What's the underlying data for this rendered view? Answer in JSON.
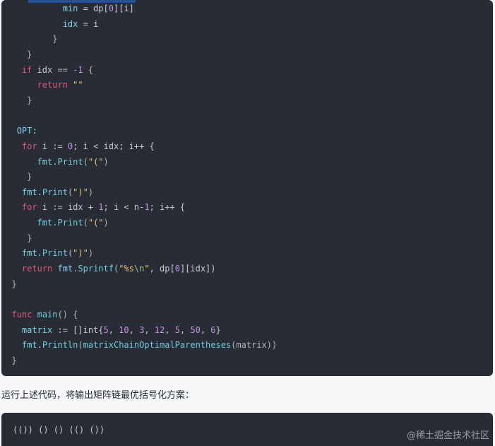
{
  "code": {
    "lines": [
      [
        {
          "t": "            "
        },
        {
          "t": "min",
          "c": "var"
        },
        {
          "t": " = dp[",
          "c": "op"
        },
        {
          "t": "0",
          "c": "num"
        },
        {
          "t": "][i]",
          "c": "op"
        }
      ],
      [
        {
          "t": "            "
        },
        {
          "t": "idx",
          "c": "var"
        },
        {
          "t": " = i",
          "c": "op"
        }
      ],
      [
        {
          "t": "          "
        },
        {
          "t": "}",
          "c": "punc"
        }
      ],
      [
        {
          "t": "     "
        },
        {
          "t": "}",
          "c": "punc"
        }
      ],
      [
        {
          "t": "    "
        },
        {
          "t": "if",
          "c": "kw"
        },
        {
          "t": " idx == ",
          "c": "op"
        },
        {
          "t": "-1",
          "c": "num"
        },
        {
          "t": " {",
          "c": "punc"
        }
      ],
      [
        {
          "t": "       "
        },
        {
          "t": "return",
          "c": "kw"
        },
        {
          "t": " ",
          "c": "op"
        },
        {
          "t": "\"\"",
          "c": "str"
        }
      ],
      [
        {
          "t": "     "
        },
        {
          "t": "}",
          "c": "punc"
        }
      ],
      [],
      [
        {
          "t": "   "
        },
        {
          "t": "OPT:",
          "c": "var"
        }
      ],
      [
        {
          "t": "    "
        },
        {
          "t": "for",
          "c": "kw"
        },
        {
          "t": " i := ",
          "c": "op"
        },
        {
          "t": "0",
          "c": "num"
        },
        {
          "t": "; i < idx; i++ {",
          "c": "op"
        }
      ],
      [
        {
          "t": "       "
        },
        {
          "t": "fmt.",
          "c": "var"
        },
        {
          "t": "Print",
          "c": "fn"
        },
        {
          "t": "(",
          "c": "punc"
        },
        {
          "t": "\"(\"",
          "c": "str"
        },
        {
          "t": ")",
          "c": "punc"
        }
      ],
      [
        {
          "t": "     "
        },
        {
          "t": "}",
          "c": "punc"
        }
      ],
      [
        {
          "t": "    "
        },
        {
          "t": "fmt.",
          "c": "var"
        },
        {
          "t": "Print",
          "c": "fn"
        },
        {
          "t": "(",
          "c": "punc"
        },
        {
          "t": "\")\"",
          "c": "str"
        },
        {
          "t": ")",
          "c": "punc"
        }
      ],
      [
        {
          "t": "    "
        },
        {
          "t": "for",
          "c": "kw"
        },
        {
          "t": " i := idx + ",
          "c": "op"
        },
        {
          "t": "1",
          "c": "num"
        },
        {
          "t": "; i < n-",
          "c": "op"
        },
        {
          "t": "1",
          "c": "num"
        },
        {
          "t": "; i++ {",
          "c": "op"
        }
      ],
      [
        {
          "t": "       "
        },
        {
          "t": "fmt.",
          "c": "var"
        },
        {
          "t": "Print",
          "c": "fn"
        },
        {
          "t": "(",
          "c": "punc"
        },
        {
          "t": "\"(\"",
          "c": "str"
        },
        {
          "t": ")",
          "c": "punc"
        }
      ],
      [
        {
          "t": "     "
        },
        {
          "t": "}",
          "c": "punc"
        }
      ],
      [
        {
          "t": "    "
        },
        {
          "t": "fmt.",
          "c": "var"
        },
        {
          "t": "Print",
          "c": "fn"
        },
        {
          "t": "(",
          "c": "punc"
        },
        {
          "t": "\")\"",
          "c": "str"
        },
        {
          "t": ")",
          "c": "punc"
        }
      ],
      [
        {
          "t": "    "
        },
        {
          "t": "return",
          "c": "kw"
        },
        {
          "t": " fmt.",
          "c": "var"
        },
        {
          "t": "Sprintf",
          "c": "fn"
        },
        {
          "t": "(",
          "c": "punc"
        },
        {
          "t": "\"%s",
          "c": "str"
        },
        {
          "t": "\\n",
          "c": "esc"
        },
        {
          "t": "\"",
          "c": "str"
        },
        {
          "t": ", dp[",
          "c": "op"
        },
        {
          "t": "0",
          "c": "num"
        },
        {
          "t": "][idx])",
          "c": "op"
        }
      ],
      [
        {
          "t": "  "
        },
        {
          "t": "}",
          "c": "punc"
        }
      ],
      [],
      [
        {
          "t": "  "
        },
        {
          "t": "func",
          "c": "kw"
        },
        {
          "t": " ",
          "c": "op"
        },
        {
          "t": "main",
          "c": "fn"
        },
        {
          "t": "() {",
          "c": "punc"
        }
      ],
      [
        {
          "t": "    "
        },
        {
          "t": "matrix",
          "c": "var"
        },
        {
          "t": " := []int{",
          "c": "op"
        },
        {
          "t": "5",
          "c": "num"
        },
        {
          "t": ", ",
          "c": "op"
        },
        {
          "t": "10",
          "c": "num"
        },
        {
          "t": ", ",
          "c": "op"
        },
        {
          "t": "3",
          "c": "num"
        },
        {
          "t": ", ",
          "c": "op"
        },
        {
          "t": "12",
          "c": "num"
        },
        {
          "t": ", ",
          "c": "op"
        },
        {
          "t": "5",
          "c": "num"
        },
        {
          "t": ", ",
          "c": "op"
        },
        {
          "t": "50",
          "c": "num"
        },
        {
          "t": ", ",
          "c": "op"
        },
        {
          "t": "6",
          "c": "num"
        },
        {
          "t": "}",
          "c": "op"
        }
      ],
      [
        {
          "t": "    "
        },
        {
          "t": "fmt.",
          "c": "var"
        },
        {
          "t": "Println",
          "c": "fn"
        },
        {
          "t": "(",
          "c": "punc"
        },
        {
          "t": "matrixChainOptimalParentheses",
          "c": "fn"
        },
        {
          "t": "(matrix))",
          "c": "punc"
        }
      ],
      [
        {
          "t": "  "
        },
        {
          "t": "}",
          "c": "punc"
        }
      ]
    ]
  },
  "prose": {
    "sentence": "运行上述代码，将输出矩阵链最优括号化方案："
  },
  "output": {
    "text": "(()) () () (() ())"
  },
  "watermark": {
    "text": "@稀土掘金技术社区"
  },
  "colors": {
    "code_bg": "#282c34",
    "page_bg": "#f7f8fa",
    "keyword": "#e4557a",
    "function": "#6ecbdd",
    "string": "#e6c07b",
    "number": "#c792ea"
  }
}
